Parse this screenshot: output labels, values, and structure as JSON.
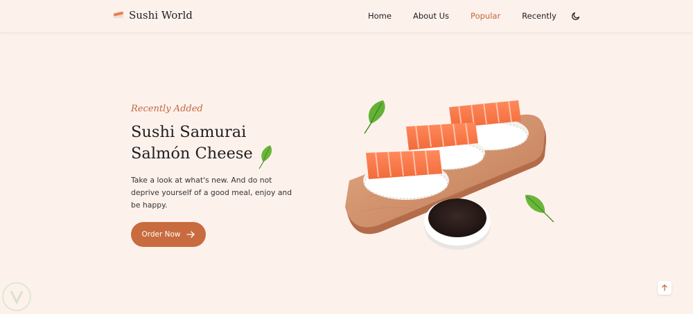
{
  "header": {
    "logo_text": "Sushi World",
    "nav": [
      {
        "label": "Home",
        "active": false
      },
      {
        "label": "About Us",
        "active": false
      },
      {
        "label": "Popular",
        "active": true
      },
      {
        "label": "Recently",
        "active": false
      }
    ],
    "theme_icon": "moon-icon"
  },
  "hero": {
    "tag": "Recently Added",
    "title_line1": "Sushi Samurai",
    "title_line2": "Salmón Cheese",
    "description": "Take a look at what's new. And do not deprive yourself of a good meal, enjoy and be happy.",
    "button_label": "Order Now",
    "button_icon": "arrow-right-icon"
  },
  "colors": {
    "background": "#fdf1ec",
    "accent": "#c86b3f",
    "text": "#1e1e1e"
  }
}
